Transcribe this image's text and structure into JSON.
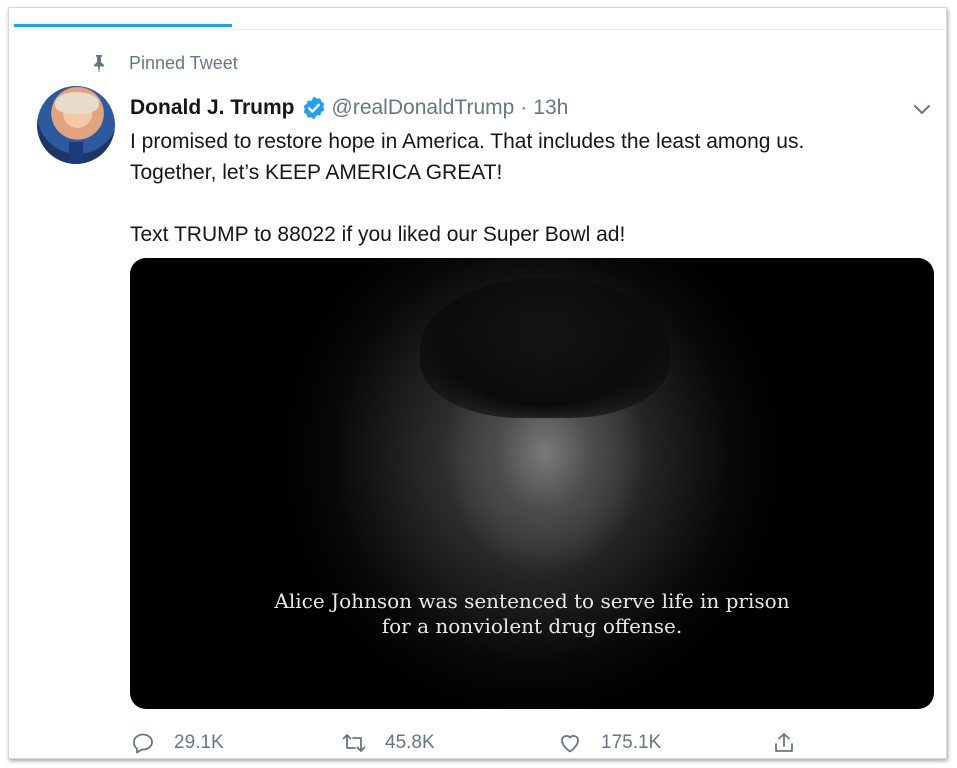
{
  "pinned": {
    "label": "Pinned Tweet",
    "icon": "pin-icon"
  },
  "author": {
    "name": "Donald J. Trump",
    "verified_icon": "verified-badge-icon",
    "handle": "@realDonaldTrump",
    "separator": "·",
    "time": "13h"
  },
  "tweet": {
    "lines": [
      "I promised to restore hope in America. That includes the least among us.",
      "Together, let’s KEEP AMERICA GREAT!",
      "Text TRUMP to 88022 if you liked our Super Bowl ad!"
    ]
  },
  "media": {
    "caption_line1": "Alice Johnson was sentenced to serve life in prison",
    "caption_line2": "for a nonviolent drug offense."
  },
  "actions": {
    "reply_count": "29.1K",
    "retweet_count": "45.8K",
    "like_count": "175.1K"
  },
  "colors": {
    "accent": "#1da1f2",
    "secondary_text": "#657786",
    "primary_text": "#14171a"
  }
}
